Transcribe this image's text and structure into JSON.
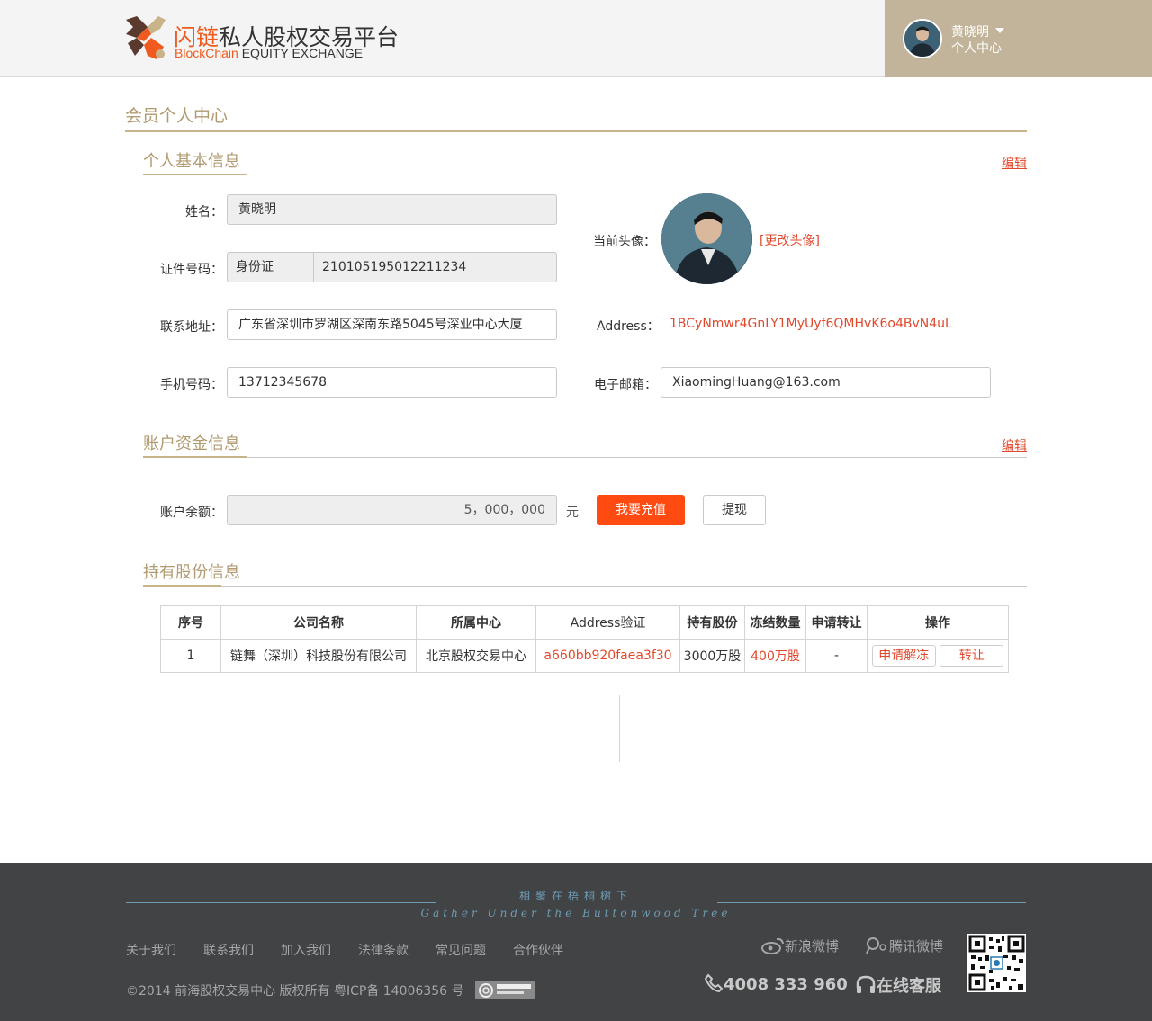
{
  "header": {
    "logo_cn_highlight": "闪链",
    "logo_cn_rest": "私人股权交易平台",
    "logo_en_highlight": "BlockChain",
    "logo_en_rest": "EQUITY EXCHANGE",
    "user_name": "黄晓明",
    "user_sub": "个人中心"
  },
  "page": {
    "title": "会员个人中心"
  },
  "basic": {
    "title": "个人基本信息",
    "edit": "编辑",
    "name_label": "姓名：",
    "name_value": "黄晓明",
    "id_label": "证件号码：",
    "id_type": "身份证",
    "id_number": "210105195012211234",
    "contact_label": "联系地址：",
    "contact_value": "广东省深圳市罗湖区深南东路5045号深业中心大厦",
    "phone_label": "手机号码：",
    "phone_value": "13712345678",
    "avatar_label": "当前头像：",
    "change_avatar": "[更改头像]",
    "address_label": "Address：",
    "address_value": "1BCyNmwr4GnLY1MyUyf6QMHvK6o4BvN4uL",
    "email_label": "电子邮箱：",
    "email_value": "XiaomingHuang@163.com"
  },
  "funds": {
    "title": "账户资金信息",
    "edit": "编辑",
    "balance_label": "账户余额：",
    "balance_value": "5，000，000",
    "unit": "元",
    "recharge": "我要充值",
    "withdraw": "提现"
  },
  "shares": {
    "title": "持有股份信息",
    "headers": [
      "序号",
      "公司名称",
      "所属中心",
      "Address验证",
      "持有股份",
      "冻结数量",
      "申请转让",
      "操作"
    ],
    "rows": [
      {
        "index": "1",
        "company": "链舞（深圳）科技股份有限公司",
        "center": "北京股权交易中心",
        "address": "a660bb920faea3f30",
        "held": "3000万股",
        "frozen": "400万股",
        "transfer_apply": "-",
        "action_unfreeze": "申请解冻",
        "action_transfer": "转让"
      }
    ]
  },
  "footer": {
    "slogan_cn": "相聚在梧桐树下",
    "slogan_en": "Gather Under the Buttonwood Tree",
    "links": [
      "关于我们",
      "联系我们",
      "加入我们",
      "法律条款",
      "常见问题",
      "合作伙伴"
    ],
    "copyright": "©2014 前海股权交易中心 版权所有   粤ICP备 14006356 号",
    "weibo_sina": "新浪微博",
    "weibo_tencent": "腾讯微博",
    "hotline": "4008 333 960",
    "online_service": "在线客服"
  },
  "colors": {
    "accent_gold": "#b09a70",
    "header_user_bg": "#c2b49a",
    "brand_orange": "#f05a1e",
    "link_red": "#e0492c",
    "button_orange": "#ff4a12",
    "footer_bg": "#414345"
  }
}
